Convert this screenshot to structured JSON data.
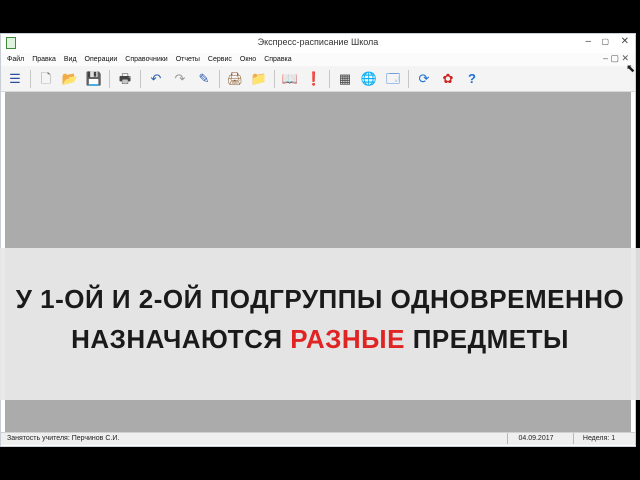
{
  "window": {
    "title": "Экспресс-расписание Школа"
  },
  "menu": [
    "Файл",
    "Правка",
    "Вид",
    "Операции",
    "Справочники",
    "Отчеты",
    "Сервис",
    "Окно",
    "Справка"
  ],
  "toolbar": {
    "icons": [
      "list-icon",
      "new-document-icon",
      "open-folder-icon",
      "save-icon",
      "print-icon",
      "undo-icon",
      "redo-icon",
      "edit-icon",
      "printer-alt-icon",
      "folder-icon",
      "book-icon",
      "alert-document-icon",
      "calculator-icon",
      "globe-icon",
      "window-icon",
      "refresh-icon",
      "flower-icon",
      "help-icon"
    ]
  },
  "statusbar": {
    "teacher_load": "Занятость учителя: Перчинов С.И.",
    "date": "04.09.2017",
    "week": "Неделя: 1"
  },
  "caption": {
    "line1": "У 1-ОЙ И 2-ОЙ ПОДГРУППЫ ОДНОВРЕМЕННО",
    "line2_before": "НАЗНАЧАЮТСЯ ",
    "line2_highlight": "РАЗНЫЕ",
    "line2_after": " ПРЕДМЕТЫ",
    "highlight_color": "#e02424"
  },
  "colors": {
    "workspace": "#ababab",
    "caption_bg": "#e8e8e8"
  }
}
